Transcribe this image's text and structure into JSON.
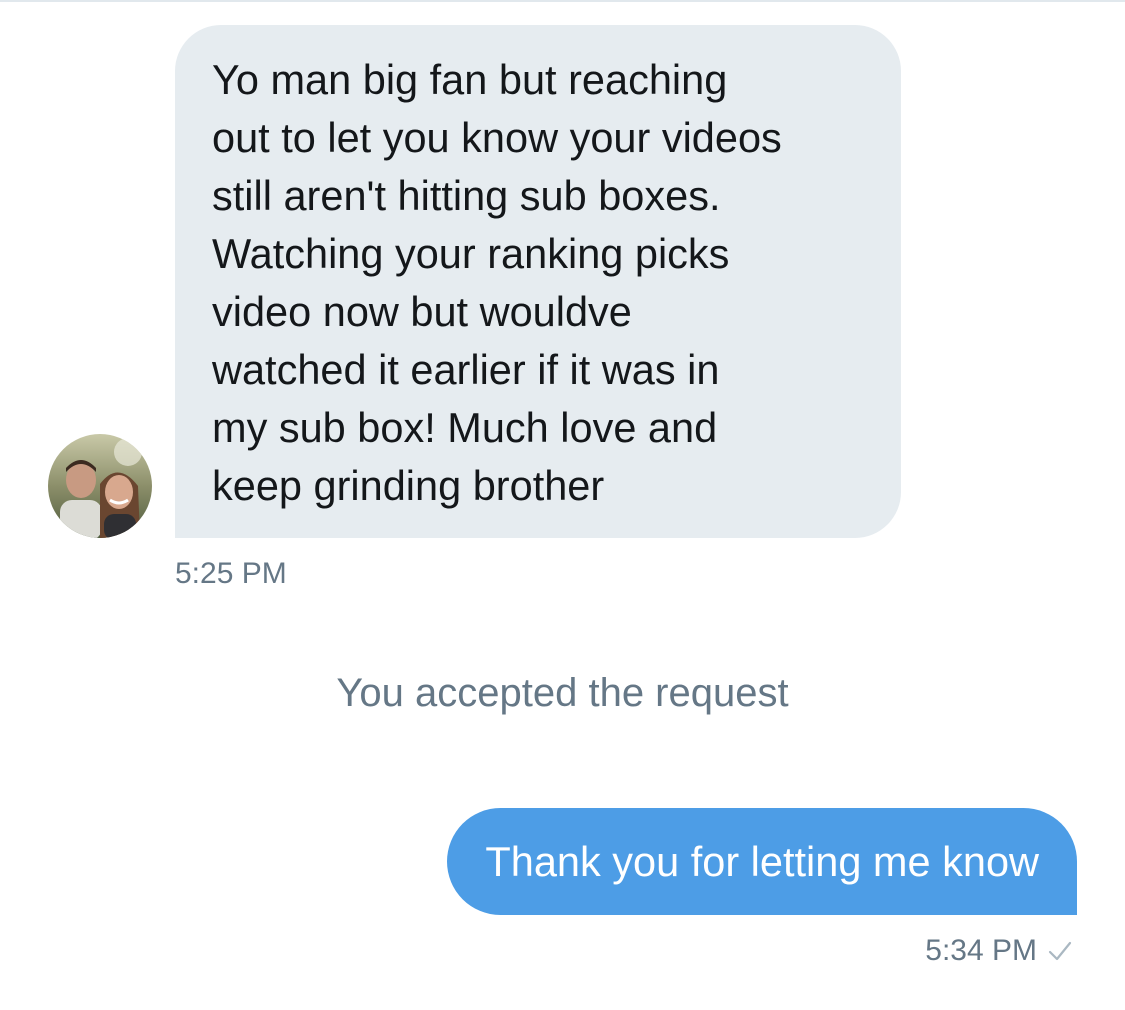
{
  "conversation": {
    "incoming": {
      "avatar_icon": "profile-photo",
      "message": "Yo man big fan but reaching\nout to let you know your videos\nstill aren't hitting sub boxes.\nWatching your ranking picks\nvideo now but wouldve\nwatched it earlier if it was in\nmy sub box! Much love and\nkeep grinding  brother",
      "timestamp": "5:25 PM"
    },
    "system_message": "You accepted the request",
    "outgoing": {
      "message": "Thank you for letting me know",
      "timestamp": "5:34 PM",
      "status_icon": "checkmark-icon"
    }
  },
  "colors": {
    "incoming_bubble": "#e6ecf0",
    "outgoing_bubble": "#4d9de6",
    "meta_text": "#657786"
  }
}
